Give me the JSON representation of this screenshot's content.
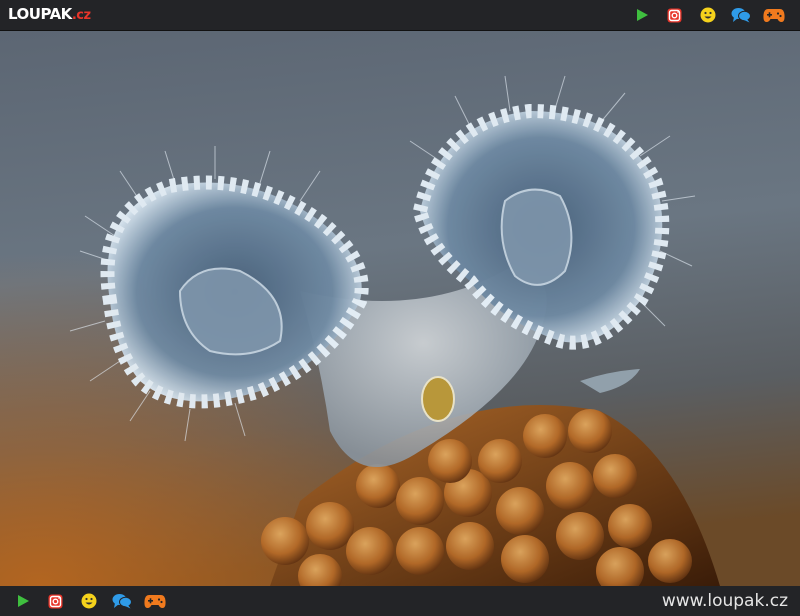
{
  "header": {
    "logo_main": "LOUPAK",
    "logo_tld": ".cz",
    "icons": [
      "play-icon",
      "instagram-icon",
      "smiley-icon",
      "chat-icon",
      "gamepad-icon"
    ]
  },
  "footer": {
    "site_url": "www.loupak.cz",
    "icons": [
      "play-icon",
      "instagram-icon",
      "smiley-icon",
      "chat-icon",
      "gamepad-icon"
    ]
  },
  "colors": {
    "bar": "#232427",
    "play": "#3fbf3f",
    "instagram": "#e8352a",
    "smiley": "#f5d21c",
    "chat": "#2f9be8",
    "gamepad": "#f07a1e"
  }
}
